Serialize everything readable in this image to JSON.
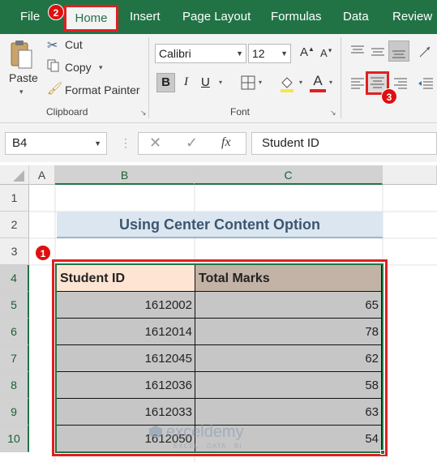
{
  "menu": {
    "tabs": [
      "File",
      "Home",
      "Insert",
      "Page Layout",
      "Formulas",
      "Data",
      "Review"
    ],
    "active_tab": "Home"
  },
  "ribbon": {
    "clipboard": {
      "paste": "Paste",
      "cut": "Cut",
      "copy": "Copy",
      "format_painter": "Format Painter",
      "group_label": "Clipboard"
    },
    "font": {
      "font_name": "Calibri",
      "font_size": "12",
      "bold": "B",
      "italic": "I",
      "underline": "U",
      "font_color_letter": "A",
      "group_label": "Font"
    }
  },
  "formula_bar": {
    "name_box": "B4",
    "fx": "fx",
    "content": "Student ID"
  },
  "grid": {
    "columns": [
      "A",
      "B",
      "C"
    ],
    "rows": [
      "1",
      "2",
      "3",
      "4",
      "5",
      "6",
      "7",
      "8",
      "9",
      "10"
    ],
    "title": "Using Center Content Option",
    "headers": [
      "Student ID",
      "Total Marks"
    ],
    "data": [
      {
        "id": "1612002",
        "marks": "65"
      },
      {
        "id": "1612014",
        "marks": "78"
      },
      {
        "id": "1612045",
        "marks": "62"
      },
      {
        "id": "1612036",
        "marks": "58"
      },
      {
        "id": "1612033",
        "marks": "63"
      },
      {
        "id": "1612050",
        "marks": "54"
      }
    ]
  },
  "badges": [
    "1",
    "2",
    "3"
  ],
  "watermark": {
    "brand": "exceldemy",
    "tagline": "EXCEL · DATA · BI"
  },
  "colors": {
    "excel_green": "#217346",
    "highlight_red": "#e02020",
    "header_fill": "#c2b3a6",
    "id_header_fill": "#fde4d3",
    "data_fill": "#c6c6c6",
    "title_fill": "#dce6f0"
  }
}
